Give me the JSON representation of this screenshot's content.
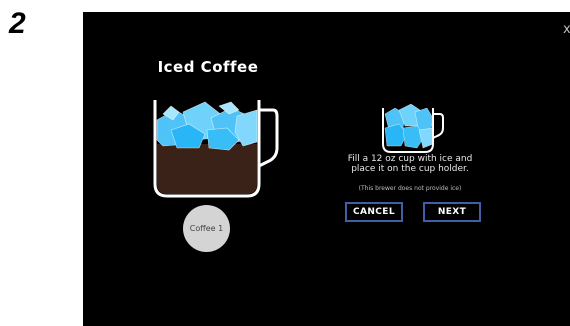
{
  "step": {
    "number": "2"
  },
  "screen": {
    "close_glyph": "x",
    "title": "Iced Coffee",
    "size_label": "Coffee 1",
    "instruction_line1": "Fill a 12 oz cup with ice and",
    "instruction_line2": "place it on the cup holder.",
    "note": "(This brewer does not provide ice)",
    "cancel_label": "CANCEL",
    "next_label": "NEXT"
  },
  "icons": {
    "large": "iced-coffee-mug-icon",
    "small": "ice-cup-icon",
    "close": "close-icon"
  },
  "colors": {
    "screen_bg": "#000000",
    "ice": "#4fc3f7",
    "coffee": "#3b2218",
    "button_border": "#3f5fa8",
    "size_button": "#d4d4d4"
  }
}
